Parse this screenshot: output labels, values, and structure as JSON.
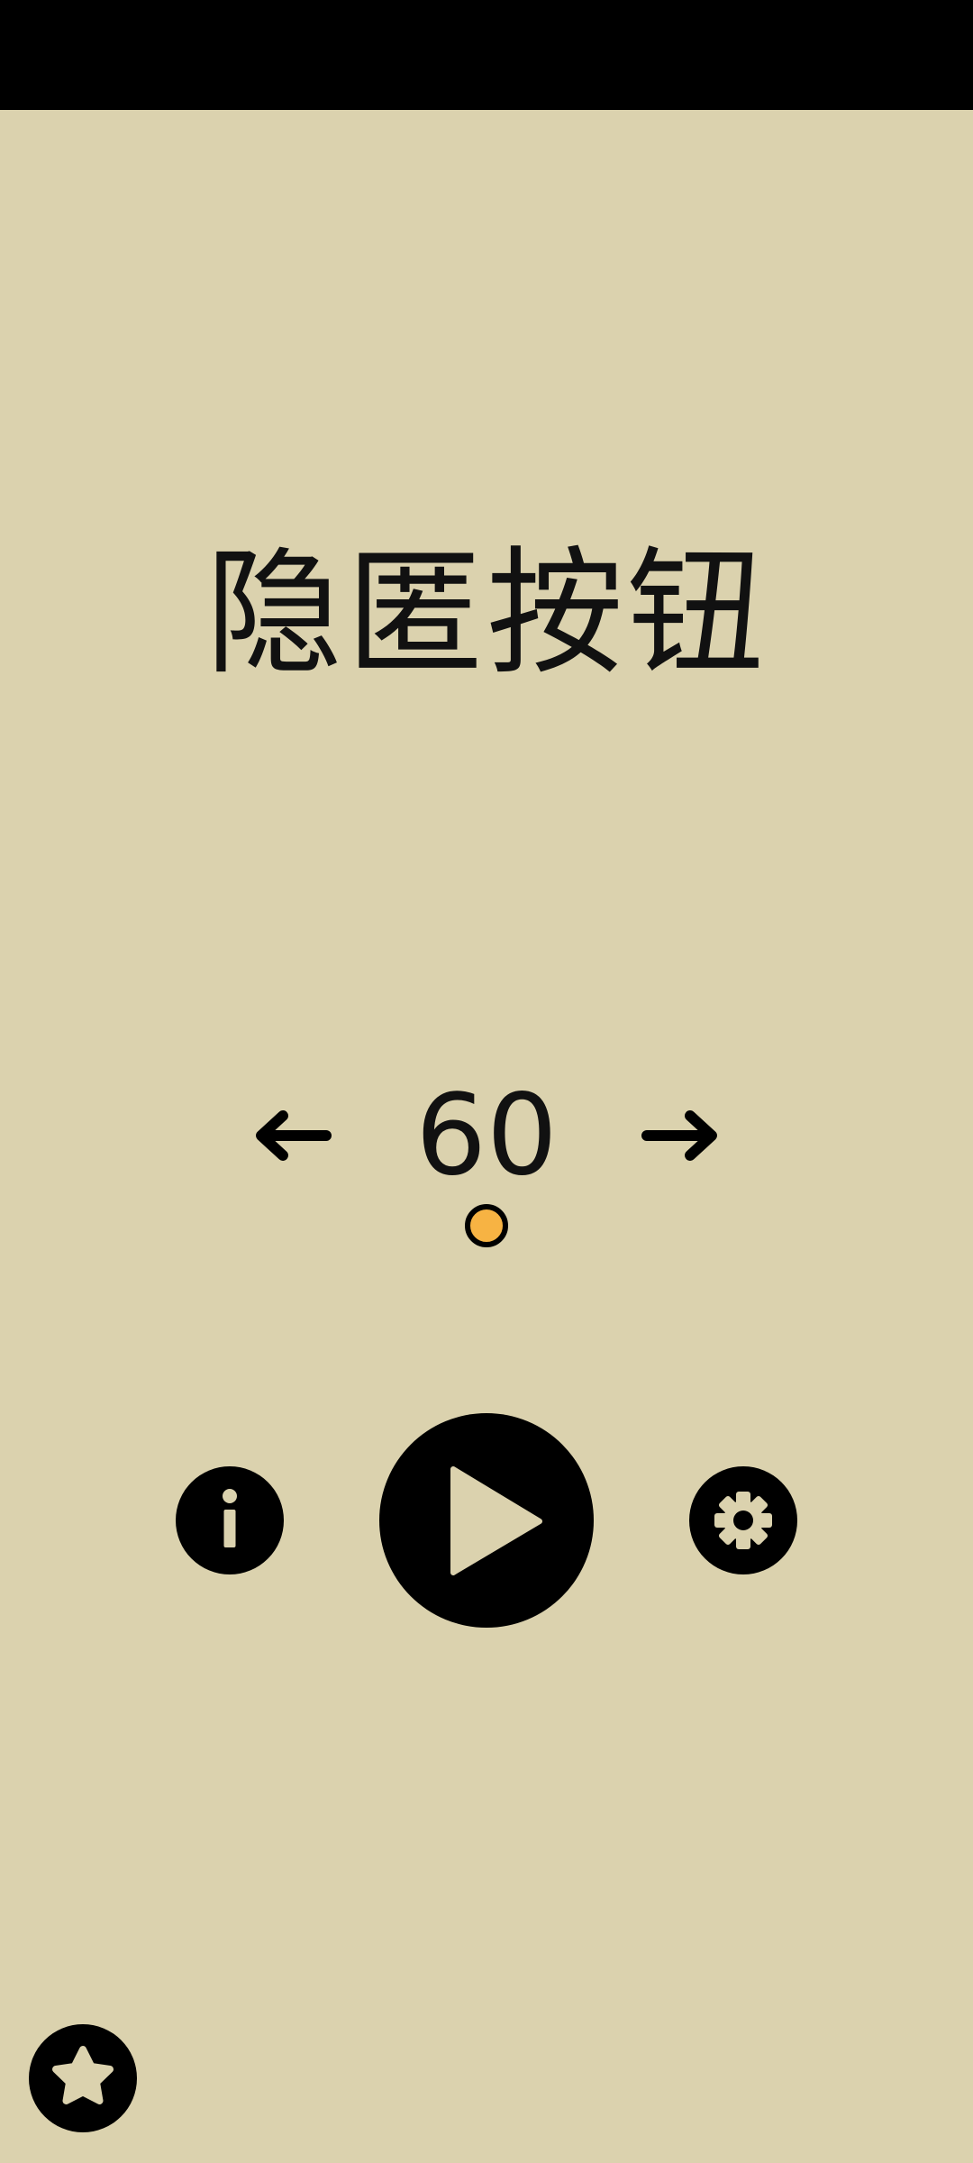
{
  "screen": {
    "title": "隐匿按钮",
    "level": "60"
  },
  "colors": {
    "background": "#dbd2ae",
    "status_bar": "#000000",
    "foreground": "#000000",
    "level_dot": "#f7b343"
  },
  "icons": {
    "previous": "arrow-left-icon",
    "next": "arrow-right-icon",
    "info": "info-icon",
    "play": "play-icon",
    "settings": "gear-icon",
    "favorites": "star-icon"
  }
}
